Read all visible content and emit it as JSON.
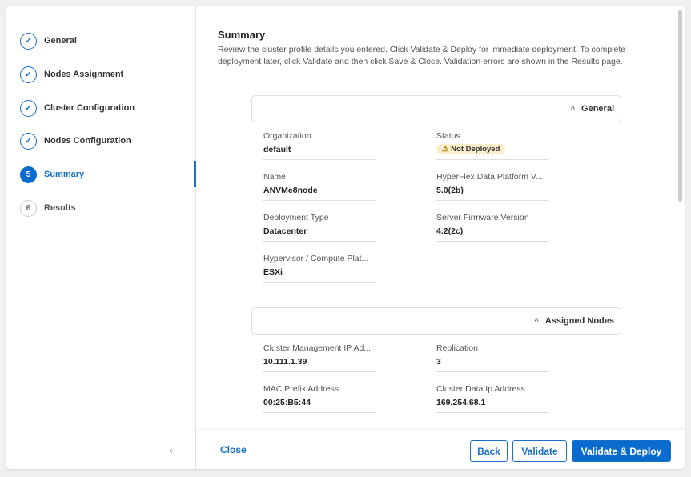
{
  "steps": [
    {
      "label": "General",
      "state": "done"
    },
    {
      "label": "Nodes Assignment",
      "state": "done"
    },
    {
      "label": "Cluster Configuration",
      "state": "done"
    },
    {
      "label": "Nodes Configuration",
      "state": "done"
    },
    {
      "label": "Summary",
      "number": "5",
      "state": "active"
    },
    {
      "label": "Results",
      "number": "6",
      "state": "todo"
    }
  ],
  "summary": {
    "title": "Summary",
    "description": "Review the cluster profile details you entered. Click Validate & Deploy for immediate deployment. To complete deployment later, click Validate and then click Save & Close. Validation errors are shown in the Results page."
  },
  "general": {
    "title": "General",
    "fields": [
      {
        "label": "Organization",
        "value": "default"
      },
      {
        "label": "Status",
        "value": "Not Deployed"
      },
      {
        "label": "Name",
        "value": "ANVMe8node"
      },
      {
        "label": "HyperFlex Data Platform V...",
        "value": "5.0(2b)"
      },
      {
        "label": "Deployment Type",
        "value": "Datacenter"
      },
      {
        "label": "Server Firmware Version",
        "value": "4.2(2c)"
      },
      {
        "label": "Hypervisor / Compute Plat...",
        "value": "ESXi"
      }
    ]
  },
  "assigned": {
    "title": "Assigned Nodes",
    "fields": [
      {
        "label": "Cluster Management IP Ad...",
        "value": "10.111.1.39"
      },
      {
        "label": "Replication",
        "value": "3"
      },
      {
        "label": "MAC Prefix Address",
        "value": "00:25:B5:44"
      },
      {
        "label": "Cluster Data Ip Address",
        "value": "169.254.68.1"
      }
    ]
  },
  "footer": {
    "close": "Close",
    "back": "Back",
    "validate": "Validate",
    "deploy": "Validate & Deploy"
  },
  "colors": {
    "accent": "#0a6bce",
    "warning_badge": "#fbeecb"
  }
}
